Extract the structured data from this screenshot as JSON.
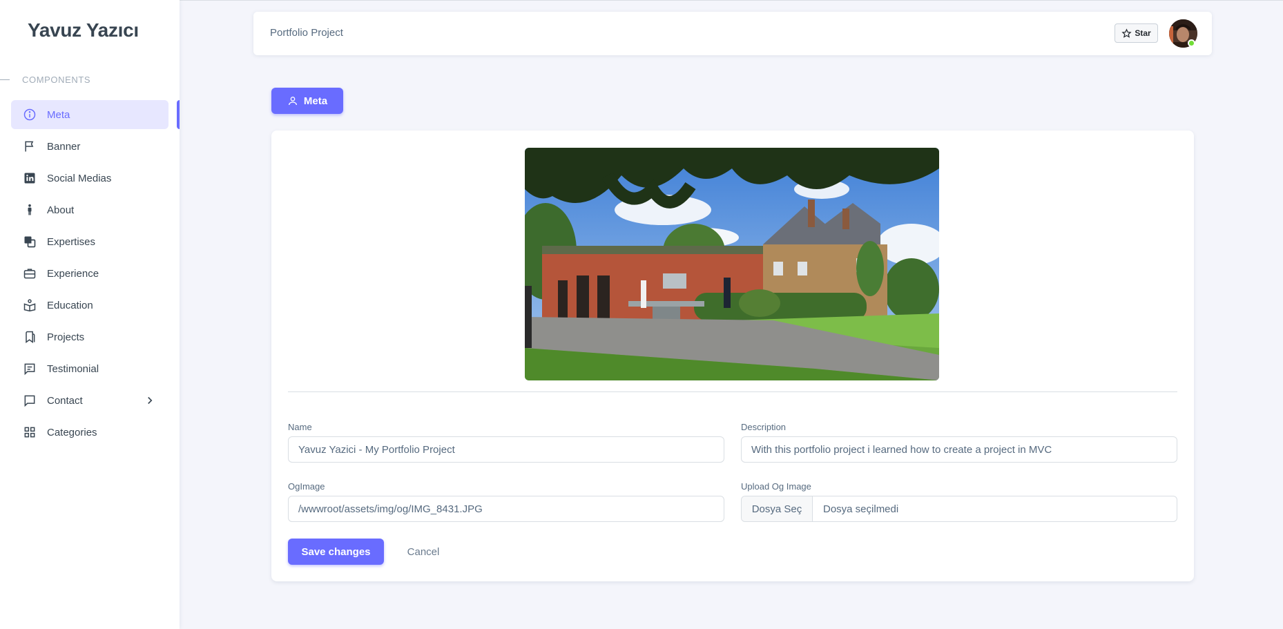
{
  "brand": "Yavuz Yazıcı",
  "sidebar": {
    "section_header": "COMPONENTS",
    "items": [
      {
        "label": "Meta",
        "icon": "info-circle-icon"
      },
      {
        "label": "Banner",
        "icon": "flag-icon"
      },
      {
        "label": "Social Medias",
        "icon": "linkedin-icon"
      },
      {
        "label": "About",
        "icon": "person-icon"
      },
      {
        "label": "Expertises",
        "icon": "layers-icon"
      },
      {
        "label": "Experience",
        "icon": "briefcase-icon"
      },
      {
        "label": "Education",
        "icon": "book-reader-icon"
      },
      {
        "label": "Projects",
        "icon": "bookmarks-icon"
      },
      {
        "label": "Testimonial",
        "icon": "message-detail-icon"
      },
      {
        "label": "Contact",
        "icon": "chat-icon"
      },
      {
        "label": "Categories",
        "icon": "grid-icon"
      }
    ],
    "active_index": 0,
    "accent": "#696cff"
  },
  "navbar": {
    "title": "Portfolio Project",
    "star_label": "Star"
  },
  "tab_button": "Meta",
  "form": {
    "name_label": "Name",
    "name_value": "Yavuz Yazici - My Portfolio Project",
    "description_label": "Description",
    "description_value": "With this portfolio project i learned how to create a project in MVC",
    "ogimage_label": "OgImage",
    "ogimage_value": "/wwwroot/assets/img/og/IMG_8431.JPG",
    "upload_label": "Upload Og Image",
    "upload_button": "Dosya Seç",
    "upload_status": "Dosya seçilmedi",
    "save_label": "Save changes",
    "cancel_label": "Cancel"
  },
  "colors": {
    "primary": "#696cff",
    "online": "#71dd37"
  }
}
